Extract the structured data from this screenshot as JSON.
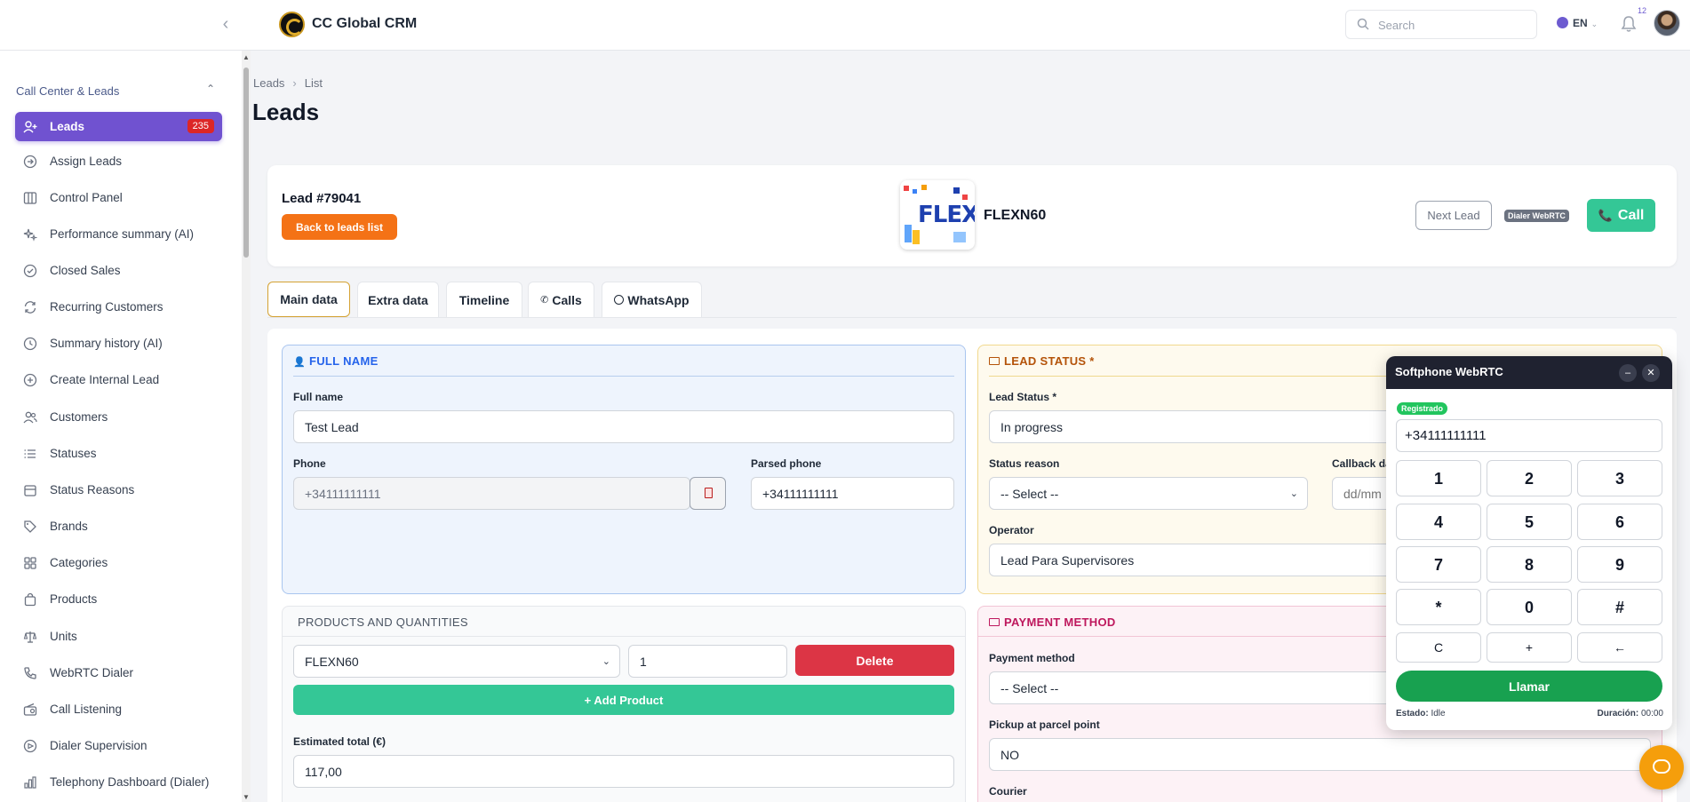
{
  "app": {
    "title": "CC Global CRM"
  },
  "topbar": {
    "search_placeholder": "Search",
    "language": "EN",
    "notification_count": "12"
  },
  "sidebar": {
    "section": "Call Center & Leads",
    "items": [
      {
        "label": "Leads",
        "icon": "user-plus-icon",
        "badge": "235",
        "active": true
      },
      {
        "label": "Assign Leads",
        "icon": "arrow-circle-icon"
      },
      {
        "label": "Control Panel",
        "icon": "columns-icon"
      },
      {
        "label": "Performance summary (AI)",
        "icon": "sparkles-icon"
      },
      {
        "label": "Closed Sales",
        "icon": "check-circle-icon"
      },
      {
        "label": "Recurring Customers",
        "icon": "refresh-icon"
      },
      {
        "label": "Summary history (AI)",
        "icon": "clock-icon"
      },
      {
        "label": "Create Internal Lead",
        "icon": "plus-circle-icon"
      },
      {
        "label": "Customers",
        "icon": "users-icon"
      },
      {
        "label": "Statuses",
        "icon": "list-icon"
      },
      {
        "label": "Status Reasons",
        "icon": "archive-icon"
      },
      {
        "label": "Brands",
        "icon": "tag-icon"
      },
      {
        "label": "Categories",
        "icon": "grid-icon"
      },
      {
        "label": "Products",
        "icon": "shopping-bag-icon"
      },
      {
        "label": "Units",
        "icon": "scale-icon"
      },
      {
        "label": "WebRTC Dialer",
        "icon": "phone-icon"
      },
      {
        "label": "Call Listening",
        "icon": "radio-icon"
      },
      {
        "label": "Dialer Supervision",
        "icon": "eye-icon"
      },
      {
        "label": "Telephony Dashboard (Dialer)",
        "icon": "bar-chart-icon"
      }
    ]
  },
  "breadcrumb": {
    "root": "Leads",
    "current": "List"
  },
  "page": {
    "title": "Leads"
  },
  "lead": {
    "id_label": "Lead #79041",
    "back_label": "Back to leads list",
    "product_name": "FLEXN60",
    "product_logo_text": "FLEX",
    "next_label": "Next Lead",
    "dialer_tag": "Dialer WebRTC",
    "call_label": "Call"
  },
  "tabs": [
    {
      "label": "Main data",
      "active": true
    },
    {
      "label": "Extra data"
    },
    {
      "label": "Timeline"
    },
    {
      "label": "Calls"
    },
    {
      "label": "WhatsApp"
    }
  ],
  "full_name_section": {
    "heading": "FULL NAME",
    "name_label": "Full name",
    "name_value": "Test Lead",
    "phone_label": "Phone",
    "phone_value": "+34111111111",
    "parsed_label": "Parsed phone",
    "parsed_value": "+34111111111"
  },
  "lead_status_section": {
    "heading": "LEAD STATUS *",
    "status_label": "Lead Status *",
    "status_value": "In progress",
    "reason_label": "Status reason",
    "reason_value": "-- Select --",
    "callback_label": "Callback da",
    "callback_placeholder": "dd/mm",
    "operator_label": "Operator",
    "operator_value": "Lead Para Supervisores"
  },
  "products_section": {
    "heading": "PRODUCTS AND QUANTITIES",
    "product_value": "FLEXN60",
    "quantity_value": "1",
    "delete_label": "Delete",
    "add_label": "+ Add Product",
    "total_label": "Estimated total (€)",
    "total_value": "117,00"
  },
  "payment_section": {
    "heading": "PAYMENT METHOD",
    "method_label": "Payment method",
    "method_value": "-- Select --",
    "pickup_label": "Pickup at parcel point",
    "pickup_value": "NO",
    "courier_label": "Courier"
  },
  "softphone": {
    "title": "Softphone WebRTC",
    "status_badge": "Registrado",
    "number": "+34111111111",
    "keys": [
      "1",
      "2",
      "3",
      "4",
      "5",
      "6",
      "7",
      "8",
      "9",
      "*",
      "0",
      "#"
    ],
    "bottom_keys": [
      "C",
      "+",
      "←"
    ],
    "call_label": "Llamar",
    "state_label": "Estado:",
    "state_value": "Idle",
    "duration_label": "Duración:",
    "duration_value": "00:00"
  },
  "colors": {
    "accent": "#7052d0",
    "badge_red": "#dc2626",
    "orange": "#f47216",
    "teal": "#34c796",
    "danger": "#dc3545",
    "call_green": "#18a150"
  }
}
